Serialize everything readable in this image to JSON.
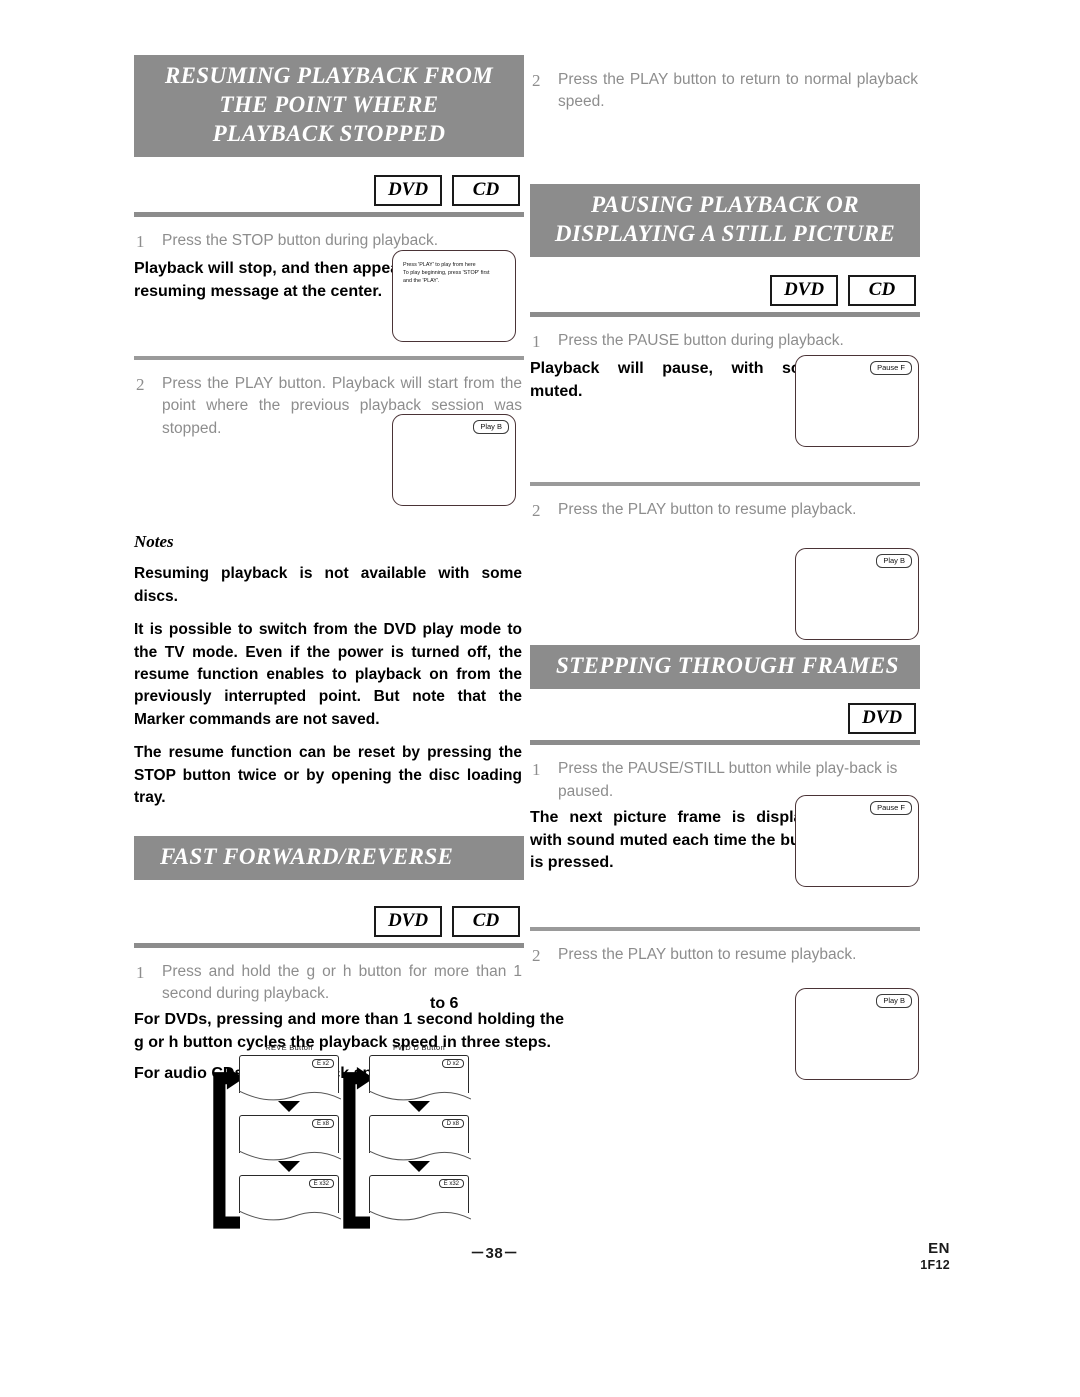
{
  "page": {
    "number": "－38－",
    "language": "EN",
    "code": "1F12"
  },
  "left_column": {
    "section1": {
      "title_line1": "RESUMING PLAYBACK FROM",
      "title_line2": "THE POINT WHERE",
      "title_line3": "PLAYBACK STOPPED",
      "badges": [
        "DVD",
        "CD"
      ],
      "steps": [
        {
          "num": "1",
          "text": "Press the STOP button during playback."
        },
        {
          "num": "2",
          "text": "Press the PLAY button. Playback will start from the point where the previous playback session was stopped."
        }
      ],
      "result1": "Playback will stop, and then appear the resuming message at the center.",
      "tv1_message": "Press 'PLAY' to play from here\nTo play beginning, press 'STOP' first\nand the 'PLAY'.",
      "tv2_osd": "Play B"
    },
    "notes": {
      "heading": "Notes",
      "items": [
        "Resuming playback is not available with some discs.",
        "It is possible to switch from the DVD play mode to the TV mode. Even if the power is turned off, the resume function enables to playback on from the previously interrupted point. But note that the Marker commands are not saved.",
        "The resume function can be reset by pressing the STOP button twice or by opening the disc loading tray."
      ]
    },
    "section2": {
      "title": "FAST FORWARD/REVERSE",
      "badges": [
        "DVD",
        "CD"
      ],
      "steps": [
        {
          "num": "1",
          "text": "Press and hold the  g    or h    button for more than 1 second during playback."
        }
      ],
      "result1": "For DVDs, pressing and more than 1 second holding the g   or h     button cycles the playback speed in three steps.",
      "result2": "For audio CDs, the playback speed is fixed.",
      "result2_overlap": "to 6"
    },
    "diagram": {
      "rev_label": "REVE    Button",
      "fwd_label": "FWD D   Button",
      "rev_speeds": [
        "E  x2",
        "E  x8",
        "E  x32"
      ],
      "fwd_speeds": [
        "D  x2",
        "D  x8",
        "E  x32"
      ]
    }
  },
  "right_column": {
    "top_step": {
      "num": "2",
      "text": "Press the PLAY button to return to normal playback speed."
    },
    "section1": {
      "title_line1": "PAUSING PLAYBACK OR",
      "title_line2": "DISPLAYING A STILL PICTURE",
      "badges": [
        "DVD",
        "CD"
      ],
      "steps": [
        {
          "num": "1",
          "text": "Press the PAUSE button during playback."
        },
        {
          "num": "2",
          "text": "Press the PLAY button to resume playback."
        }
      ],
      "result1": "Playback will pause, with sound muted.",
      "tv1_osd": "Pause F",
      "tv2_osd": "Play B"
    },
    "section2": {
      "title": "STEPPING THROUGH FRAMES",
      "badges": [
        "DVD"
      ],
      "steps": [
        {
          "num": "1",
          "text": "Press the PAUSE/STILL button while play-back is paused."
        },
        {
          "num": "2",
          "text": "Press the PLAY button to resume playback."
        }
      ],
      "result1": "The next picture frame is displayed with sound muted each time the button is pressed.",
      "tv1_osd": "Pause F",
      "tv2_osd": "Play B"
    }
  },
  "colors": {
    "section_bar": "#8c8c8c",
    "body_text": "#8d8d8d",
    "bold_text": "#000000"
  }
}
